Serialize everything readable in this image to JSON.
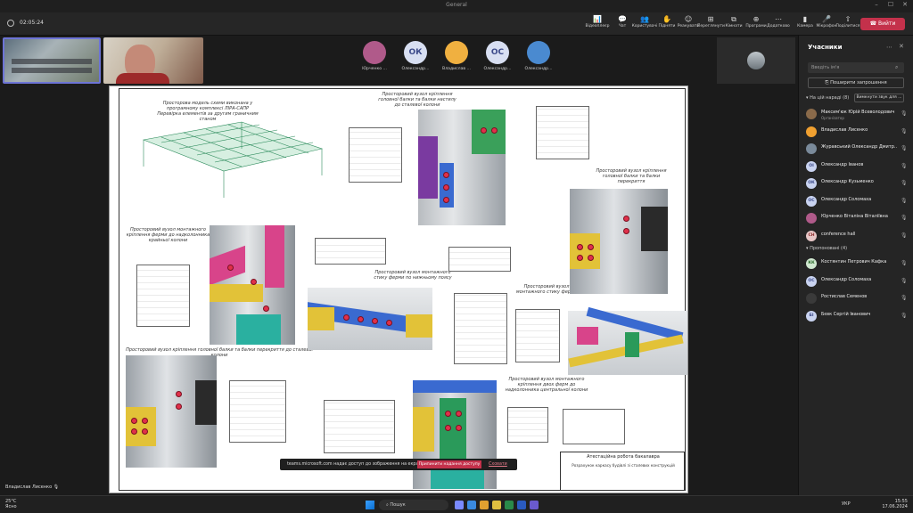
{
  "window": {
    "title": "General"
  },
  "toolbar": {
    "timer": "02:05:24",
    "buttons": [
      {
        "label": "Відеоплеєр",
        "icon": "📊"
      },
      {
        "label": "Чат",
        "icon": "💬"
      },
      {
        "label": "Користувачі",
        "icon": "👥"
      },
      {
        "label": "Підняти",
        "icon": "✋"
      },
      {
        "label": "Реакувати",
        "icon": "☺"
      },
      {
        "label": "Переглянути",
        "icon": "⊞"
      },
      {
        "label": "Кімнати",
        "icon": "⧉"
      },
      {
        "label": "Програми",
        "icon": "⊕"
      },
      {
        "label": "Додатково",
        "icon": "⋯"
      },
      {
        "label": "Камера",
        "icon": "▮"
      },
      {
        "label": "Мікрофон",
        "icon": "🎤"
      },
      {
        "label": "Поділитися",
        "icon": "⇧"
      }
    ],
    "leave_label": "Вийти"
  },
  "strip": [
    {
      "name": "Юрченко ...",
      "initials": "",
      "bg": "#b05a8a"
    },
    {
      "name": "Олександр...",
      "initials": "ОК",
      "bg": "#d8dff2",
      "fg": "#3c4a8a"
    },
    {
      "name": "Владислав ...",
      "initials": "",
      "bg": "#f0b040"
    },
    {
      "name": "Олександр...",
      "initials": "ОС",
      "bg": "#d8dff2",
      "fg": "#3c4a8a"
    },
    {
      "name": "Олександр...",
      "initials": "",
      "bg": "#4a8ad0"
    }
  ],
  "drawing": {
    "captions": [
      "Просторова модель схеми виконана у програмному комплексі ЛІРА-САПР Перевірка елементів за другим граничним станом",
      "Просторовий вузол кріплення головної балки та балки настилу до сталевої колони",
      "Просторовий вузол кріплення головної балки та балки перекриття",
      "Просторовий вузол монтажного кріплення ферми до надколонника крайньої колони",
      "Просторовий вузол монтажного стику ферми по нижньому поясу",
      "Просторовий вузол монтажного стику ферми",
      "Просторовий вузол кріплення головної балки та балки перекриття до сталевої колони",
      "Просторовий вузол монтажного кріплення двох ферм до надколонника центральної колони"
    ],
    "stamp_title": "Атестаційна робота бакалавра",
    "stamp_sub": "Розрахунок каркасу будівлі зі сталевих конструкцій"
  },
  "share_notice": {
    "text": "teams.microsoft.com надає доступ до зображення на екрані.",
    "stop_label": "Припинити надання доступу",
    "hide_label": "Сховати"
  },
  "presenter": {
    "name": "Владислав Лисенко"
  },
  "panel": {
    "title": "Учасники",
    "search_placeholder": "Введіть ім'я",
    "invite_label": "Поширити запрошення",
    "in_meeting_label": "На цій нараді (8)",
    "mute_all_label": "Вимкнути звук для ...",
    "invited_label": "Пропоновані (4)",
    "organizer_label": "Організатор",
    "in_meeting": [
      {
        "name": "Максим'юк Юрій Всеволодович",
        "role": "Організатор",
        "initials": "",
        "bg": "#8a6a4a"
      },
      {
        "name": "Владислав Лисенко",
        "initials": "",
        "bg": "#f0a030"
      },
      {
        "name": "Журавський Олександр Дмитр...",
        "initials": "",
        "bg": "#7a8a9a"
      },
      {
        "name": "Олександр Іванов",
        "initials": "ОІ",
        "bg": "#c9d3f0",
        "fg": "#3c4a8a"
      },
      {
        "name": "Олександр Кузьменко",
        "initials": "ОК",
        "bg": "#c9d3f0",
        "fg": "#3c4a8a"
      },
      {
        "name": "Олександр Соломаха",
        "initials": "ОС",
        "bg": "#c9d3f0",
        "fg": "#3c4a8a"
      },
      {
        "name": "Юрченко Віталіна Віталіївна",
        "initials": "",
        "bg": "#b05a8a"
      },
      {
        "name": "conference hall",
        "initials": "CH",
        "bg": "#e8c8c8",
        "fg": "#8a2a2a"
      }
    ],
    "invited": [
      {
        "name": "Костянтин Петрович Кафка",
        "initials": "КК",
        "bg": "#d0e8d0",
        "fg": "#2a6a2a"
      },
      {
        "name": "Олександр Соломаха",
        "initials": "ОС",
        "bg": "#c9d3f0",
        "fg": "#3c4a8a"
      },
      {
        "name": "Ростислав Семенов",
        "initials": "",
        "bg": "#3a3a3a"
      },
      {
        "name": "Бєвк Сергій Іванович",
        "initials": "БІ",
        "bg": "#c9d3f0",
        "fg": "#3c4a8a"
      }
    ]
  },
  "taskbar": {
    "temp": "25°C",
    "weather": "Ясно",
    "search": "Пошук",
    "lang": "УКР",
    "time": "15:55",
    "date": "17.06.2024"
  }
}
